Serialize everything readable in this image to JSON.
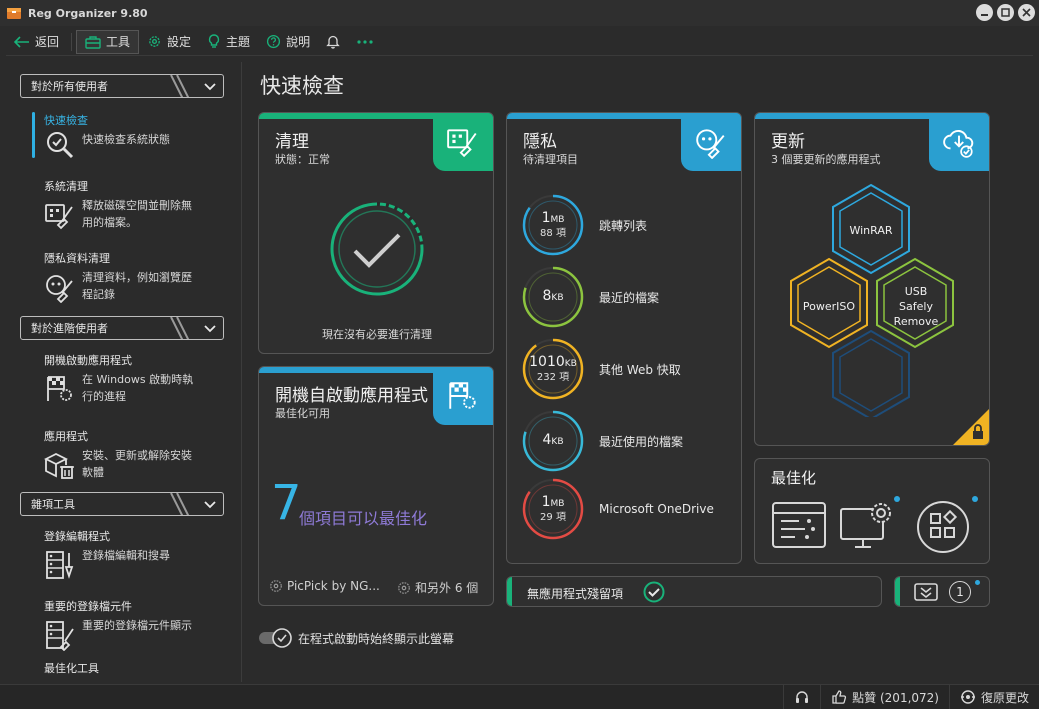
{
  "window": {
    "title": "Reg Organizer 9.80"
  },
  "toolbar": {
    "back": "返回",
    "tools": "工具",
    "settings": "設定",
    "theme": "主題",
    "help": "說明"
  },
  "sidebar": {
    "sections": [
      {
        "label": "對於所有使用者"
      },
      {
        "label": "對於進階使用者"
      },
      {
        "label": "雜項工具"
      }
    ],
    "items": [
      {
        "title": "快速檢查",
        "desc": [
          "快速檢查系統狀態"
        ]
      },
      {
        "title": "系統清理",
        "desc": [
          "釋放磁碟空間並刪除無",
          "用的檔案。"
        ]
      },
      {
        "title": "隱私資料清理",
        "desc": [
          "清理資料，例如瀏覽歷",
          "程記錄"
        ]
      },
      {
        "title": "開機啟動應用程式",
        "desc": [
          "在 Windows 啟動時執",
          "行的進程"
        ]
      },
      {
        "title": "應用程式",
        "desc": [
          "安裝、更新或解除安裝",
          "軟體"
        ]
      },
      {
        "title": "登錄編輯程式",
        "desc": [
          "登錄檔編輯和搜尋"
        ]
      },
      {
        "title": "重要的登錄檔元件",
        "desc": [
          "重要的登錄檔元件顯示"
        ]
      },
      {
        "title": "最佳化工具",
        "desc": []
      }
    ]
  },
  "main": {
    "title": "快速檢查",
    "clean": {
      "title": "清理",
      "status": "狀態：正常",
      "message": "現在沒有必要進行清理"
    },
    "startup": {
      "title": "開機自啟動應用程式",
      "subtitle": "最佳化可用",
      "count": "7",
      "count_text": "個項目可以最佳化",
      "app1": "PicPick by NG...",
      "app2": "和另外 6 個"
    },
    "privacy": {
      "title": "隱私",
      "subtitle": "待清理項目",
      "items": [
        {
          "size": "1",
          "unit": "MB",
          "count": "88 項",
          "label": "跳轉列表",
          "color": "#2ea8de",
          "frac": 0.85
        },
        {
          "size": "8",
          "unit": "KB",
          "count": "",
          "label": "最近的檔案",
          "color": "#8cc43f",
          "frac": 0.8
        },
        {
          "size": "1010",
          "unit": "KB",
          "count": "232 項",
          "label": "其他 Web 快取",
          "color": "#f0b323",
          "frac": 0.9
        },
        {
          "size": "4",
          "unit": "KB",
          "count": "",
          "label": "最近使用的檔案",
          "color": "#38b9d8",
          "frac": 0.8
        },
        {
          "size": "1",
          "unit": "MB",
          "count": "29 項",
          "label": "Microsoft OneDrive",
          "color": "#e34b44",
          "frac": 0.85
        }
      ]
    },
    "updates": {
      "title": "更新",
      "subtitle": "3 個要更新的應用程式",
      "apps": [
        "WinRAR",
        "PowerISO",
        "USB",
        "Safely",
        "Remove"
      ]
    },
    "optimize": {
      "title": "最佳化"
    },
    "leftovers": {
      "label": "無應用程式殘留項"
    },
    "badge_count": "1",
    "always_show": "在程式啟動時始終顯示此螢幕"
  },
  "statusbar": {
    "like": "點贊 (201,072)",
    "restore": "復原更改"
  },
  "colors": {
    "green": "#19b27a",
    "blue": "#2a9fd0",
    "accent_text": "#37b5e6",
    "purple": "#8e7ad6"
  }
}
